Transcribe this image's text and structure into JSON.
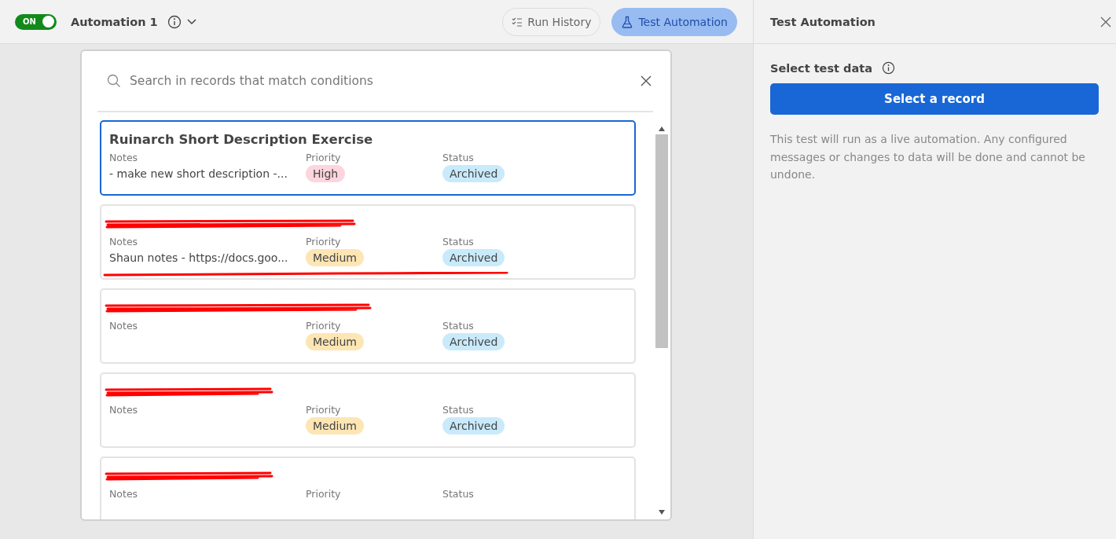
{
  "header": {
    "toggle": {
      "label": "ON",
      "on": true
    },
    "automation_name": "Automation 1",
    "buttons": [
      {
        "label": "Run History",
        "kind": "history",
        "selected": false
      },
      {
        "label": "Test Automation",
        "kind": "test",
        "selected": true
      }
    ]
  },
  "record_picker": {
    "search": {
      "placeholder": "Search in records that match conditions"
    },
    "records": [
      {
        "title": "Ruinarch Short Description Exercise",
        "title_redacted": false,
        "selected": true,
        "labels": {
          "notes": "Notes",
          "priority": "Priority",
          "status": "Status"
        },
        "notes": "- make new short description -...",
        "priority": {
          "label": "High",
          "color": "#fdd5de"
        },
        "status": {
          "label": "Archived",
          "color": "#c9eafb"
        },
        "row_struck": false
      },
      {
        "title_redacted": true,
        "selected": false,
        "labels": {
          "notes": "Notes",
          "priority": "Priority",
          "status": "Status"
        },
        "notes": "Shaun notes - https://docs.goo...",
        "priority": {
          "label": "Medium",
          "color": "#fde6b4"
        },
        "status": {
          "label": "Archived",
          "color": "#c9eafb"
        },
        "row_struck": true
      },
      {
        "title_redacted": true,
        "selected": false,
        "labels": {
          "notes": "Notes",
          "priority": "Priority",
          "status": "Status"
        },
        "priority": {
          "label": "Medium",
          "color": "#fde6b4"
        },
        "status": {
          "label": "Archived",
          "color": "#c9eafb"
        },
        "row_struck": false
      },
      {
        "title_redacted": true,
        "selected": false,
        "labels": {
          "notes": "Notes",
          "priority": "Priority",
          "status": "Status"
        },
        "priority": {
          "label": "Medium",
          "color": "#fde6b4"
        },
        "status": {
          "label": "Archived",
          "color": "#c9eafb"
        },
        "row_struck": false
      },
      {
        "title_redacted": true,
        "selected": false,
        "labels": {
          "notes": "Notes",
          "priority": "Priority",
          "status": "Status"
        },
        "row_struck": false
      }
    ]
  },
  "side_panel": {
    "title": "Test Automation",
    "section_label": "Select test data",
    "button": "Select a record",
    "description": "This test will run as a live automation. Any configured messages or changes to data will be done and cannot be undone."
  }
}
